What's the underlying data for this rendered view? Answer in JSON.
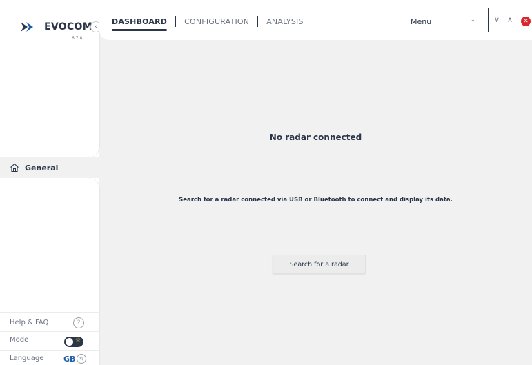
{
  "app": {
    "brand": "EVOCOM",
    "version": "6.7.8"
  },
  "tabs": [
    {
      "label": "DASHBOARD",
      "active": true
    },
    {
      "label": "CONFIGURATION",
      "active": false
    },
    {
      "label": "ANALYSIS",
      "active": false
    }
  ],
  "window": {
    "menu_label": "Menu",
    "menu_chevron": "⌄",
    "minimize_glyph": "∨",
    "maximize_glyph": "∧",
    "close_glyph": "✕",
    "close_color": "#d9272e"
  },
  "sidebar": {
    "collapse_glyph": "‹",
    "nav_general": "General",
    "help_label": "Help & FAQ",
    "help_glyph": "?",
    "mode_label": "Mode",
    "mode_sun_glyph": "☼",
    "language_label": "Language",
    "language_code": "GB",
    "language_switch_glyph": "⇆"
  },
  "main": {
    "title": "No radar connected",
    "description": "Search for a radar connected via USB or Bluetooth to connect and display its data.",
    "search_button": "Search for a radar"
  },
  "colors": {
    "accent": "#2b3648",
    "background": "#f1f1f1",
    "language": "#1f5fa8"
  }
}
